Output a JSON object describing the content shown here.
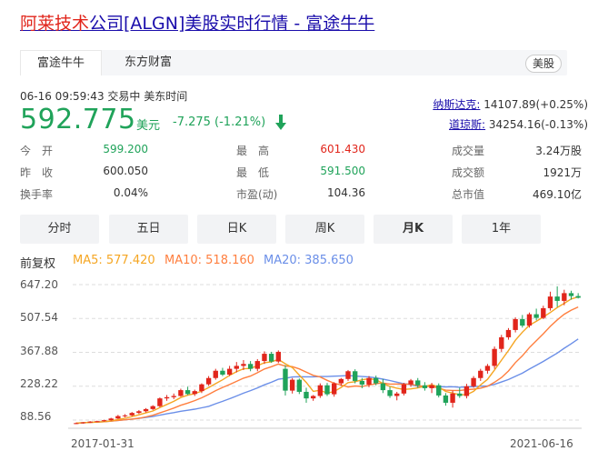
{
  "title": {
    "part1": "阿莱技术",
    "part2": "公司[ALGN]美股实时行情 - 富途牛牛"
  },
  "tabs": [
    {
      "label": "富途牛牛"
    },
    {
      "label": "东方财富"
    }
  ],
  "market_badge": "美股",
  "quote": {
    "meta": "06-16 09:59:43  交易中  美东时间",
    "price": "592.775",
    "currency": "美元",
    "change": "-7.275 (-1.21%)"
  },
  "indices": [
    {
      "label": "纳斯达克:",
      "value": "14107.89(+0.25%)"
    },
    {
      "label": "道琼斯:",
      "value": "34254.16(-0.13%)"
    }
  ],
  "stats": [
    {
      "label": "今　开",
      "value": "599.200",
      "color": "#20a35a"
    },
    {
      "label": "最　高",
      "value": "601.430",
      "color": "#e1251b"
    },
    {
      "label": "成交量",
      "value": "3.24万股",
      "color": "#333333"
    },
    {
      "label": "昨　收",
      "value": "600.050",
      "color": "#333333"
    },
    {
      "label": "最　低",
      "value": "591.500",
      "color": "#20a35a"
    },
    {
      "label": "成交额",
      "value": "1921万",
      "color": "#333333"
    },
    {
      "label": "换手率",
      "value": "0.04%",
      "color": "#333333"
    },
    {
      "label": "市盈(动)",
      "value": "104.36",
      "color": "#333333"
    },
    {
      "label": "总市值",
      "value": "469.10亿",
      "color": "#333333"
    }
  ],
  "period_buttons": [
    {
      "label": "分时"
    },
    {
      "label": "五日"
    },
    {
      "label": "日K"
    },
    {
      "label": "周K"
    },
    {
      "label": "月K",
      "active": true
    },
    {
      "label": "1年"
    }
  ],
  "legend": {
    "adjust": "前复权",
    "ma5": "MA5: 577.420",
    "ma10": "MA10: 518.160",
    "ma20": "MA20: 385.650"
  },
  "colors": {
    "up": "#e1251b",
    "down": "#20a35a",
    "ma5": "#f5a623",
    "ma10": "#ff7f3f",
    "ma20": "#6b8fe8",
    "link": "#1a0dab"
  },
  "chart_data": {
    "type": "candlestick",
    "y_ticks": [
      "647.20",
      "507.54",
      "367.88",
      "228.22",
      "88.56"
    ],
    "ylim": [
      88.56,
      647.2
    ],
    "x_ticks": [
      "2017-01-31",
      "2021-06-16"
    ],
    "candles": [
      [
        75,
        78,
        72,
        76
      ],
      [
        76,
        80,
        74,
        79
      ],
      [
        79,
        84,
        77,
        82
      ],
      [
        82,
        86,
        80,
        84
      ],
      [
        84,
        90,
        82,
        88
      ],
      [
        88,
        98,
        86,
        95
      ],
      [
        95,
        110,
        93,
        105
      ],
      [
        105,
        113,
        100,
        108
      ],
      [
        108,
        122,
        105,
        118
      ],
      [
        118,
        130,
        114,
        125
      ],
      [
        125,
        138,
        120,
        134
      ],
      [
        134,
        150,
        130,
        146
      ],
      [
        146,
        182,
        142,
        178
      ],
      [
        178,
        192,
        168,
        183
      ],
      [
        183,
        198,
        175,
        188
      ],
      [
        188,
        218,
        185,
        212
      ],
      [
        212,
        226,
        192,
        196
      ],
      [
        196,
        214,
        188,
        208
      ],
      [
        208,
        240,
        200,
        236
      ],
      [
        236,
        270,
        230,
        262
      ],
      [
        262,
        300,
        255,
        292
      ],
      [
        292,
        304,
        270,
        276
      ],
      [
        276,
        312,
        270,
        300
      ],
      [
        300,
        328,
        285,
        312
      ],
      [
        312,
        336,
        295,
        320
      ],
      [
        320,
        332,
        290,
        300
      ],
      [
        300,
        340,
        290,
        332
      ],
      [
        332,
        372,
        320,
        362
      ],
      [
        362,
        370,
        325,
        330
      ],
      [
        330,
        376,
        324,
        370
      ],
      [
        300,
        315,
        190,
        210
      ],
      [
        210,
        262,
        198,
        255
      ],
      [
        255,
        260,
        196,
        205
      ],
      [
        205,
        222,
        160,
        178
      ],
      [
        178,
        192,
        168,
        188
      ],
      [
        188,
        240,
        180,
        232
      ],
      [
        232,
        242,
        188,
        195
      ],
      [
        195,
        245,
        185,
        240
      ],
      [
        240,
        262,
        230,
        258
      ],
      [
        258,
        295,
        250,
        290
      ],
      [
        290,
        298,
        240,
        250
      ],
      [
        250,
        262,
        220,
        235
      ],
      [
        235,
        270,
        224,
        262
      ],
      [
        262,
        272,
        232,
        240
      ],
      [
        240,
        258,
        200,
        212
      ],
      [
        212,
        226,
        180,
        188
      ],
      [
        188,
        205,
        170,
        198
      ],
      [
        198,
        242,
        190,
        236
      ],
      [
        236,
        258,
        226,
        252
      ],
      [
        252,
        262,
        222,
        232
      ],
      [
        232,
        245,
        210,
        220
      ],
      [
        220,
        242,
        200,
        232
      ],
      [
        232,
        240,
        182,
        190
      ],
      [
        190,
        200,
        148,
        160
      ],
      [
        160,
        210,
        140,
        198
      ],
      [
        198,
        222,
        180,
        188
      ],
      [
        188,
        238,
        178,
        228
      ],
      [
        228,
        270,
        222,
        262
      ],
      [
        262,
        300,
        250,
        292
      ],
      [
        292,
        320,
        280,
        312
      ],
      [
        312,
        392,
        300,
        382
      ],
      [
        382,
        440,
        370,
        430
      ],
      [
        430,
        468,
        420,
        460
      ],
      [
        460,
        512,
        450,
        505
      ],
      [
        505,
        522,
        470,
        478
      ],
      [
        478,
        532,
        470,
        525
      ],
      [
        525,
        548,
        500,
        510
      ],
      [
        510,
        560,
        505,
        550
      ],
      [
        550,
        618,
        540,
        598
      ],
      [
        598,
        640,
        555,
        580
      ],
      [
        580,
        626,
        562,
        612
      ],
      [
        612,
        622,
        585,
        600
      ],
      [
        600,
        612,
        590,
        593
      ]
    ]
  }
}
